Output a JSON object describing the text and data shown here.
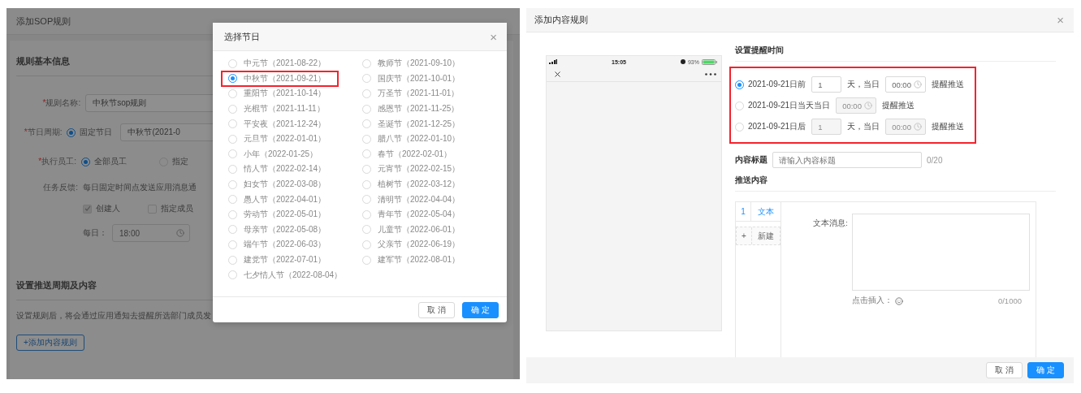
{
  "left_screen": {
    "page_title": "添加SOP规则",
    "basic_section": {
      "title": "规则基本信息",
      "fields": [
        {
          "kind": "input",
          "marker": "*",
          "label": "规则名称:",
          "value": "中秋节sop规则"
        },
        {
          "kind": "radio_select",
          "marker": "*",
          "label": "节日周期:",
          "options": [
            {
              "label": "固定节日",
              "selected": true
            }
          ],
          "select_value": "中秋节(2021-0"
        },
        {
          "kind": "radio",
          "marker": "*",
          "label": "执行员工:",
          "options": [
            {
              "label": "全部员工",
              "selected": true
            },
            {
              "label": "指定",
              "selected": false
            }
          ]
        },
        {
          "kind": "feedback",
          "label": "任务反馈:",
          "text": "每日固定时间点发送应用消息通",
          "checks": [
            {
              "label": "创建人",
              "checked": true
            },
            {
              "label": "指定成员",
              "checked": false
            }
          ],
          "time_label": "每日：",
          "time_value": "18:00"
        }
      ]
    },
    "push_section": {
      "title": "设置推送周期及内容",
      "description": "设置规则后，将会通过应用通知去提醒所选部门成员发",
      "add_button": "+添加内容规则"
    },
    "dialog": {
      "title": "选择节日",
      "close": "×",
      "options": [
        {
          "label": "中元节（2021-08-22）",
          "selected": false,
          "highlighted": false
        },
        {
          "label": "教师节（2021-09-10）",
          "selected": false,
          "highlighted": false
        },
        {
          "label": "中秋节（2021-09-21）",
          "selected": true,
          "highlighted": true
        },
        {
          "label": "国庆节（2021-10-01）",
          "selected": false,
          "highlighted": false
        },
        {
          "label": "重阳节（2021-10-14）",
          "selected": false,
          "highlighted": false
        },
        {
          "label": "万圣节（2021-11-01）",
          "selected": false,
          "highlighted": false
        },
        {
          "label": "光棍节（2021-11-11）",
          "selected": false,
          "highlighted": false
        },
        {
          "label": "感恩节（2021-11-25）",
          "selected": false,
          "highlighted": false
        },
        {
          "label": "平安夜（2021-12-24）",
          "selected": false,
          "highlighted": false
        },
        {
          "label": "圣诞节（2021-12-25）",
          "selected": false,
          "highlighted": false
        },
        {
          "label": "元旦节（2022-01-01）",
          "selected": false,
          "highlighted": false
        },
        {
          "label": "腊八节（2022-01-10）",
          "selected": false,
          "highlighted": false
        },
        {
          "label": "小年（2022-01-25）",
          "selected": false,
          "highlighted": false
        },
        {
          "label": "春节（2022-02-01）",
          "selected": false,
          "highlighted": false
        },
        {
          "label": "情人节（2022-02-14）",
          "selected": false,
          "highlighted": false
        },
        {
          "label": "元宵节（2022-02-15）",
          "selected": false,
          "highlighted": false
        },
        {
          "label": "妇女节（2022-03-08）",
          "selected": false,
          "highlighted": false
        },
        {
          "label": "植树节（2022-03-12）",
          "selected": false,
          "highlighted": false
        },
        {
          "label": "愚人节（2022-04-01）",
          "selected": false,
          "highlighted": false
        },
        {
          "label": "清明节（2022-04-04）",
          "selected": false,
          "highlighted": false
        },
        {
          "label": "劳动节（2022-05-01）",
          "selected": false,
          "highlighted": false
        },
        {
          "label": "青年节（2022-05-04）",
          "selected": false,
          "highlighted": false
        },
        {
          "label": "母亲节（2022-05-08）",
          "selected": false,
          "highlighted": false
        },
        {
          "label": "儿童节（2022-06-01）",
          "selected": false,
          "highlighted": false
        },
        {
          "label": "端午节（2022-06-03）",
          "selected": false,
          "highlighted": false
        },
        {
          "label": "父亲节（2022-06-19）",
          "selected": false,
          "highlighted": false
        },
        {
          "label": "建党节（2022-07-01）",
          "selected": false,
          "highlighted": false
        },
        {
          "label": "建军节（2022-08-01）",
          "selected": false,
          "highlighted": false
        },
        {
          "label": "七夕情人节（2022-08-04）",
          "selected": false,
          "highlighted": false
        }
      ],
      "buttons": [
        {
          "label": "取 消",
          "primary": false
        },
        {
          "label": "确 定",
          "primary": true
        }
      ]
    }
  },
  "right_screen": {
    "title": "添加内容规则",
    "close": "×",
    "preview": {
      "time": "15:05",
      "battery": "93%"
    },
    "reminder": {
      "title": "设置提醒时间",
      "highlighted": true,
      "options": [
        {
          "kind": "days",
          "label": "2021-09-21日前",
          "selected": true,
          "days": "1",
          "days_suffix": "天，当日",
          "time": "00:00",
          "suffix": "提醒推送"
        },
        {
          "kind": "same_day",
          "label": "2021-09-21日当天当日",
          "selected": false,
          "time": "00:00",
          "suffix": "提醒推送"
        },
        {
          "kind": "days",
          "label": "2021-09-21日后",
          "selected": false,
          "days": "1",
          "days_suffix": "天，当日",
          "time": "00:00",
          "suffix": "提醒推送"
        }
      ]
    },
    "content_title": {
      "label": "内容标题",
      "placeholder": "请输入内容标题",
      "counter": "0/20"
    },
    "push_content": {
      "title": "推送内容",
      "tabs": [
        {
          "index": "1",
          "label": "文本",
          "selected": true
        }
      ],
      "new_tab": {
        "icon": "+",
        "label": "新建"
      },
      "message_label": "文本消息:",
      "insert_label": "点击插入：",
      "counter": "0/1000"
    },
    "buttons": [
      {
        "label": "取 消",
        "primary": false
      },
      {
        "label": "确 定",
        "primary": true
      }
    ]
  }
}
